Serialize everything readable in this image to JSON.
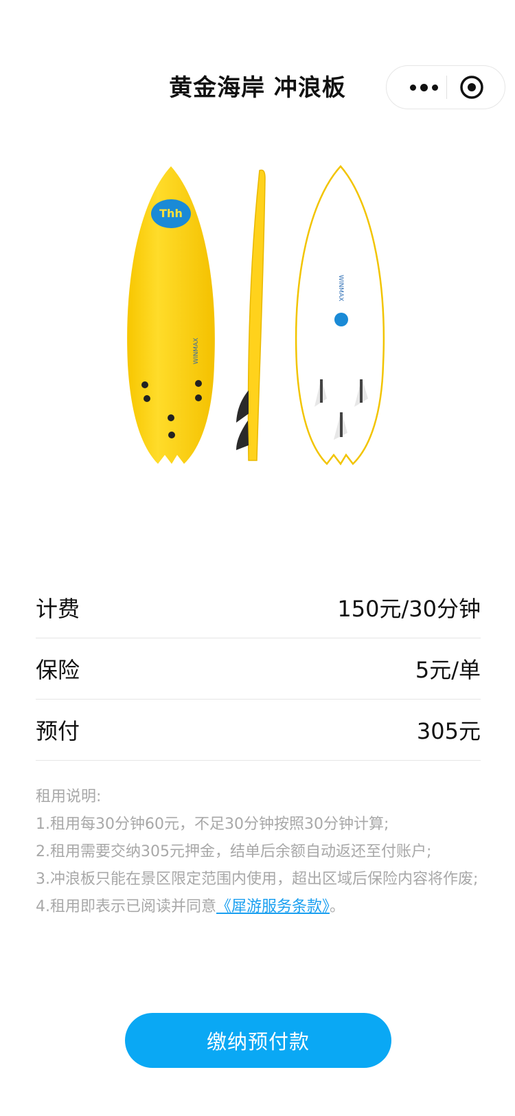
{
  "nav": {
    "title": "黄金海岸 冲浪板",
    "menu_icon": "more-dots-icon",
    "close_icon": "target-circle-icon"
  },
  "product_image": {
    "logo_text": "Thh",
    "brand_text": "WINMAX",
    "colors": {
      "board_yellow": "#fcd114",
      "board_edge": "#f2c200",
      "fin_dark": "#2a2a2a"
    }
  },
  "pricing": {
    "rows": [
      {
        "label": "计费",
        "value": "150元/30分钟"
      },
      {
        "label": "保险",
        "value": "5元/单"
      },
      {
        "label": "预付",
        "value": "305元"
      }
    ]
  },
  "notes": {
    "title": "租用说明:",
    "line1": "1.租用每30分钟60元，不足30分钟按照30分钟计算;",
    "line2": "2.租用需要交纳305元押金，结单后余额自动返还至付账户;",
    "line3": "3.冲浪板只能在景区限定范围内使用，超出区域后保险内容将作废;",
    "line4_prefix": "4.租用即表示已阅读并同意",
    "line4_link": "《犀游服务条款》",
    "line4_suffix": "。"
  },
  "actions": {
    "pay_label": "缴纳预付款"
  },
  "colors": {
    "accent": "#0aa8f4",
    "link": "#1a9ff0",
    "note_text": "#a8a8a8"
  }
}
